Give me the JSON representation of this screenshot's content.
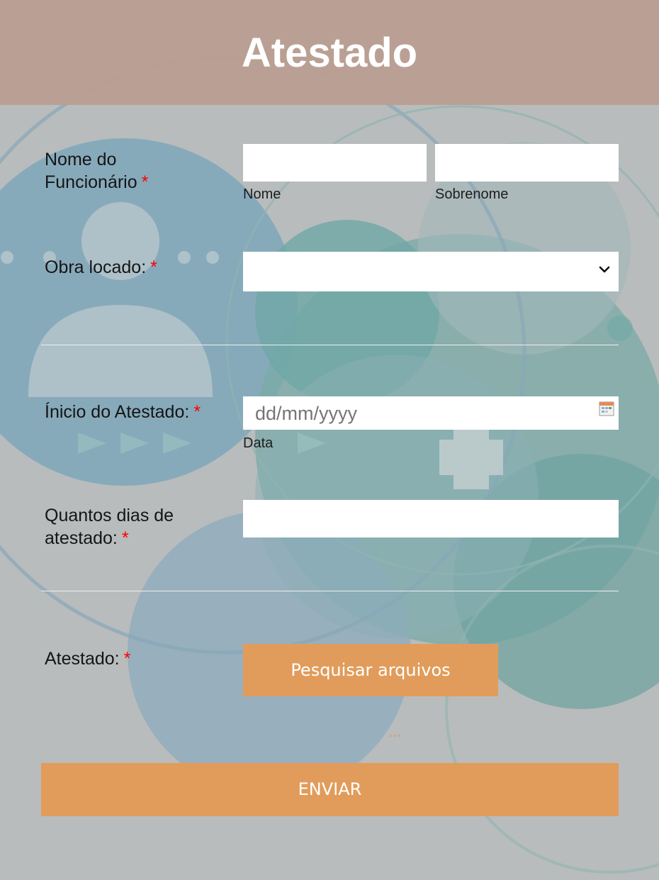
{
  "header": {
    "title": "Atestado"
  },
  "fields": {
    "employee_name": {
      "label_line1": "Nome do",
      "label_line2": "Funcionário",
      "required": "*",
      "first_sublabel": "Nome",
      "last_sublabel": "Sobrenome",
      "first_value": "",
      "last_value": ""
    },
    "site": {
      "label": "Obra locado:",
      "required": "*",
      "selected": ""
    },
    "start_date": {
      "label": "Ínicio do Atestado:",
      "required": "*",
      "placeholder": "dd/mm/yyyy",
      "sublabel": "Data"
    },
    "days": {
      "label_line1": "Quantos dias de",
      "label_line2": "atestado:",
      "required": "*",
      "value": ""
    },
    "attachment": {
      "label": "Atestado:",
      "required": "*",
      "button_label": "Pesquisar arquivos",
      "dots": "•••"
    }
  },
  "submit": {
    "label": "ENVIAR"
  },
  "colors": {
    "header_bg": "#ba9e91",
    "accent": "#e19c5b",
    "required": "#ff0000",
    "page_bg": "#b9bcbc"
  },
  "icons": [
    "chevron-down-icon",
    "calendar-icon"
  ]
}
